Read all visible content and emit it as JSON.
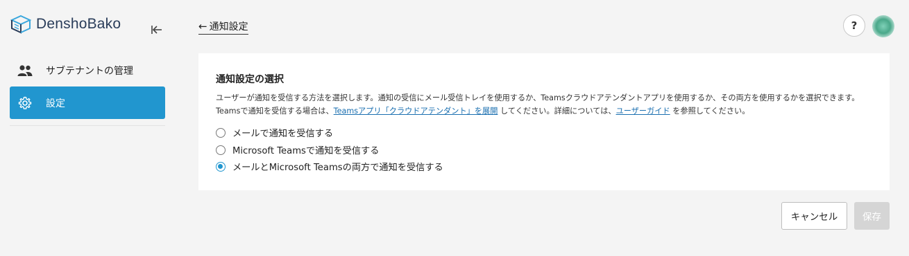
{
  "app": {
    "name": "DenshoBako"
  },
  "sidebar": {
    "items": [
      {
        "label": "サブテナントの管理",
        "icon": "users-icon"
      },
      {
        "label": "設定",
        "icon": "gear-icon",
        "active": true
      }
    ]
  },
  "header": {
    "back_label": "通知設定",
    "help_label": "?"
  },
  "card": {
    "title": "通知設定の選択",
    "desc_part1": "ユーザーが通知を受信する方法を選択します。通知の受信にメール受信トレイを使用するか、Teamsクラウドアテンダントアプリを使用するか、その両方を使用するかを選択できます。Teamsで通知を受信する場合は、",
    "link1": "Teamsアプリ「クラウドアテンダント」を展開",
    "desc_part2": " してください。詳細については、",
    "link2": "ユーザーガイド",
    "desc_part3": " を参照してください。",
    "options": [
      {
        "label": "メールで通知を受信する",
        "checked": false
      },
      {
        "label": "Microsoft Teamsで通知を受信する",
        "checked": false
      },
      {
        "label": "メールとMicrosoft Teamsの両方で通知を受信する",
        "checked": true
      }
    ]
  },
  "buttons": {
    "cancel": "キャンセル",
    "save": "保存"
  },
  "colors": {
    "accent": "#2196cf",
    "link": "#1a6fb0",
    "background": "#f4f4f4"
  }
}
